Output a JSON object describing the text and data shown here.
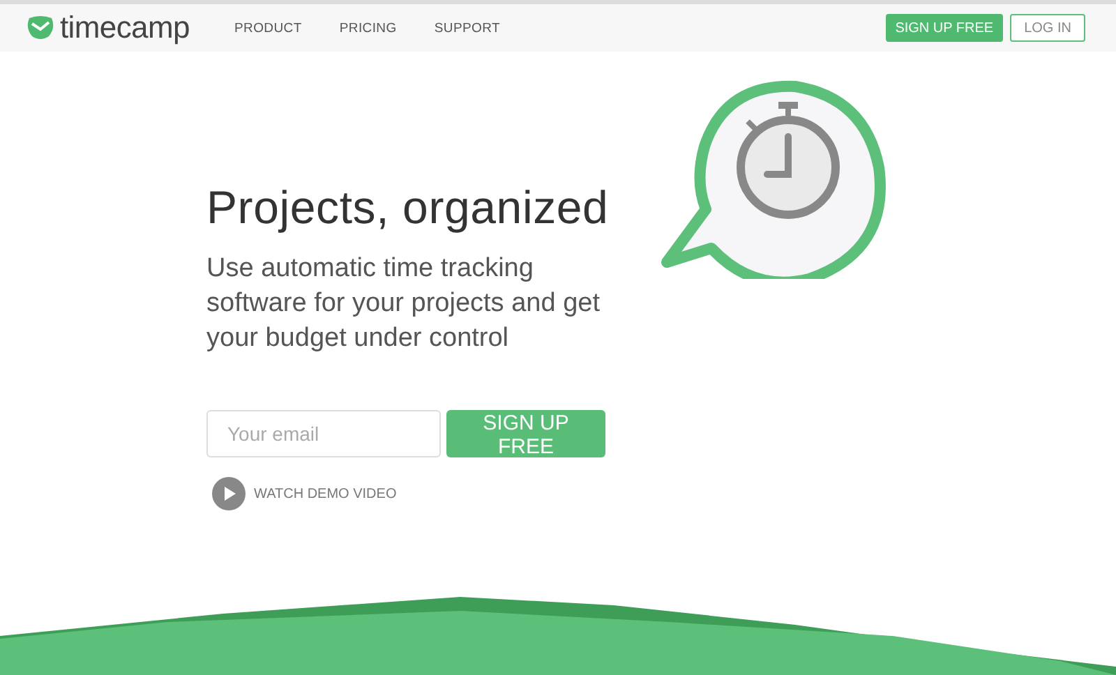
{
  "header": {
    "logo": "timecamp",
    "nav": [
      "PRODUCT",
      "PRICING",
      "SUPPORT"
    ],
    "signup_button": "SIGN UP FREE",
    "login_button": "LOG IN"
  },
  "hero": {
    "title": "Projects, organized",
    "subtitle": "Use automatic time tracking software for your projects and get your budget under control",
    "email": {
      "placeholder": "Your email"
    },
    "signup_button": "SIGN UP FREE",
    "demo_link": "WATCH DEMO VIDEO"
  }
}
